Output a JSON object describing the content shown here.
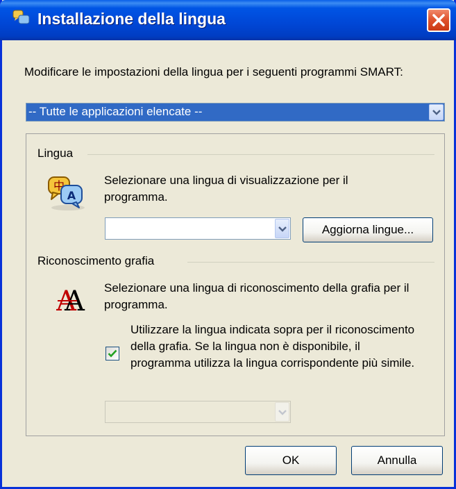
{
  "window": {
    "title": "Installazione della lingua"
  },
  "intro": {
    "text": "Modificare le impostazioni della lingua per i seguenti programmi SMART:"
  },
  "app_select": {
    "value": "-- Tutte le applicazioni elencate --"
  },
  "language_group": {
    "title": "Lingua",
    "description": "Selezionare una lingua di visualizzazione per il programma.",
    "select_value": "",
    "update_button": "Aggiorna lingue..."
  },
  "handwriting_group": {
    "title": "Riconoscimento grafia",
    "description": "Selezionare una lingua di riconoscimento della grafia per il programma.",
    "checkbox_label": "Utilizzare la lingua indicata sopra per il riconoscimento della grafia. Se la lingua non è disponibile, il programma utilizza la lingua corrispondente più simile.",
    "checkbox_checked": true,
    "select_value": ""
  },
  "buttons": {
    "ok": "OK",
    "cancel": "Annulla"
  },
  "colors": {
    "titlebar": "#0055E5",
    "selection": "#316AC5",
    "dialog_bg": "#ECE9D8",
    "close_button": "#E0552F",
    "check": "#21A121"
  }
}
